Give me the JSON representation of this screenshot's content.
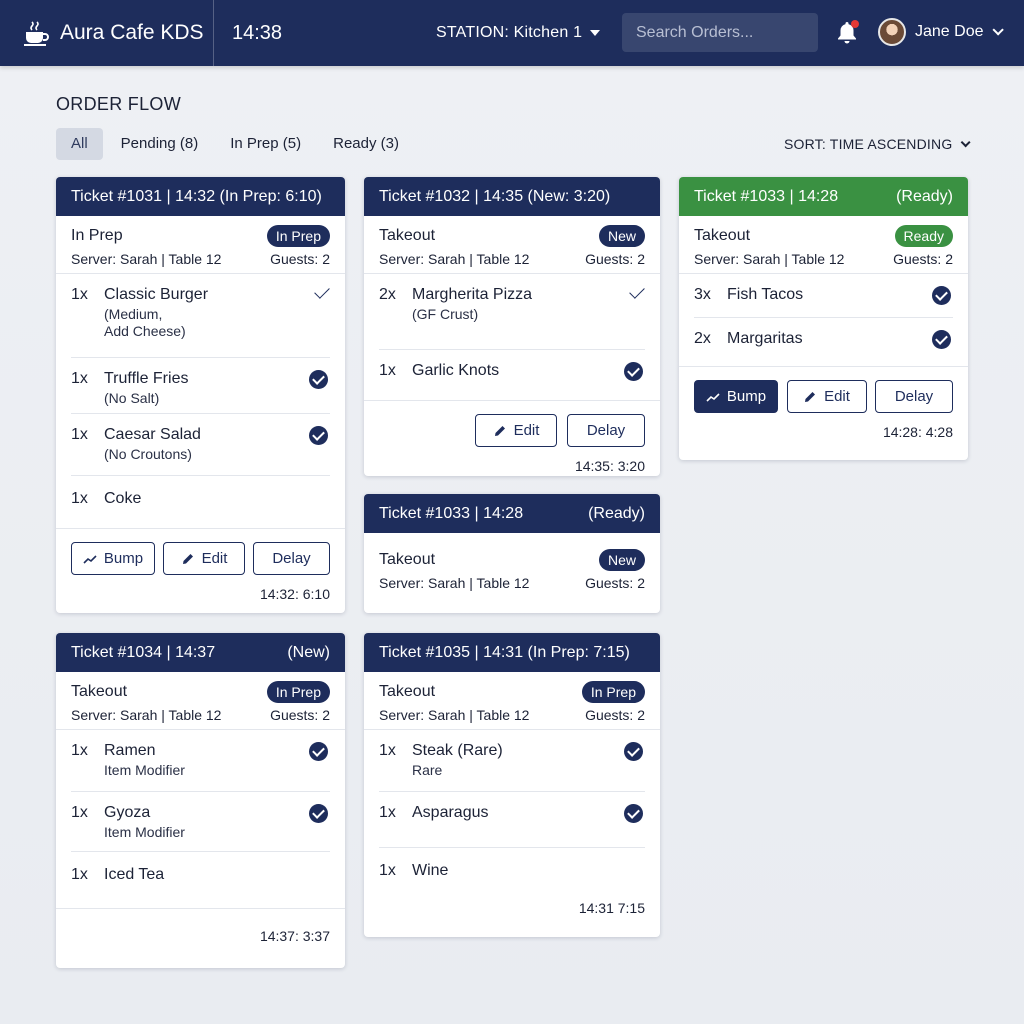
{
  "app": {
    "title": "Aura Cafe KDS",
    "clock": "14:38",
    "station": "STATION: Kitchen 1",
    "search_placeholder": "Search Orders...",
    "user_name": "Jane Doe"
  },
  "section": {
    "title": "ORDER FLOW",
    "filters": [
      "All",
      "Pending (8)",
      "In Prep (5)",
      "Ready (3)"
    ],
    "active_filter": "All",
    "sort": "SORT: TIME ASCENDING"
  },
  "colors": {
    "navy": "#1e2d5c",
    "ready_green": "#3a9142"
  },
  "buttons": {
    "bump": "Bump",
    "edit": "Edit",
    "delay": "Delay"
  },
  "tickets": {
    "t1031": {
      "head_left": "Ticket #1031 | 14:32 (In Prep: 6:10)",
      "head_right": "",
      "type": "In Prep",
      "badge": "In Prep",
      "server": "Server: Sarah | Table 12",
      "guests": "Guests: 2",
      "items": [
        {
          "qty": "1x",
          "name": "Classic Burger",
          "mod": "(Medium,\nAdd Cheese)",
          "check": "plain"
        },
        {
          "qty": "1x",
          "name": "Truffle Fries",
          "mod": "(No Salt)",
          "check": "circle"
        },
        {
          "qty": "1x",
          "name": "Caesar Salad",
          "mod": "(No Croutons)",
          "check": "circle"
        },
        {
          "qty": "1x",
          "name": "Coke",
          "mod": "",
          "check": "none"
        }
      ],
      "time": "14:32: 6:10"
    },
    "t1032": {
      "head_left": "Ticket #1032 | 14:35 (New: 3:20)",
      "head_right": "",
      "type": "Takeout",
      "badge": "New",
      "server": "Server: Sarah | Table 12",
      "guests": "Guests: 2",
      "items": [
        {
          "qty": "2x",
          "name": "Margherita Pizza",
          "mod": "(GF Crust)",
          "check": "plain"
        },
        {
          "qty": "1x",
          "name": "Garlic Knots",
          "mod": "",
          "check": "circle"
        }
      ],
      "time": "14:35: 3:20"
    },
    "t1033a": {
      "head_left": "Ticket #1033 | 14:28",
      "head_right": "(Ready)",
      "type": "Takeout",
      "badge": "Ready",
      "server": "Server: Sarah | Table 12",
      "guests": "Guests: 2",
      "items": [
        {
          "qty": "3x",
          "name": "Fish Tacos",
          "mod": "",
          "check": "circle"
        },
        {
          "qty": "2x",
          "name": "Margaritas",
          "mod": "",
          "check": "circle"
        }
      ],
      "time": "14:28: 4:28"
    },
    "t1033b": {
      "head_left": "Ticket #1033 | 14:28",
      "head_right": "(Ready)",
      "type": "Takeout",
      "badge": "New",
      "server": "Server: Sarah | Table 12",
      "guests": "Guests: 2"
    },
    "t1034": {
      "head_left": "Ticket #1034 | 14:37",
      "head_right": "(New)",
      "type": "Takeout",
      "badge": "In Prep",
      "server": "Server: Sarah | Table 12",
      "guests": "Guests: 2",
      "items": [
        {
          "qty": "1x",
          "name": "Ramen",
          "mod": "Item Modifier",
          "check": "circle"
        },
        {
          "qty": "1x",
          "name": "Gyoza",
          "mod": "Item Modifier",
          "check": "circle"
        },
        {
          "qty": "1x",
          "name": "Iced Tea",
          "mod": "",
          "check": "none"
        }
      ],
      "time": "14:37: 3:37"
    },
    "t1035": {
      "head_left": "Ticket #1035 | 14:31 (In Prep: 7:15)",
      "head_right": "",
      "type": "Takeout",
      "badge": "In Prep",
      "server": "Server: Sarah | Table 12",
      "guests": "Guests: 2",
      "items": [
        {
          "qty": "1x",
          "name": "Steak (Rare)",
          "mod": "Rare",
          "check": "circle"
        },
        {
          "qty": "1x",
          "name": "Asparagus",
          "mod": "",
          "check": "circle"
        },
        {
          "qty": "1x",
          "name": "Wine",
          "mod": "",
          "check": "none"
        }
      ],
      "time": "14:31 7:15"
    }
  }
}
